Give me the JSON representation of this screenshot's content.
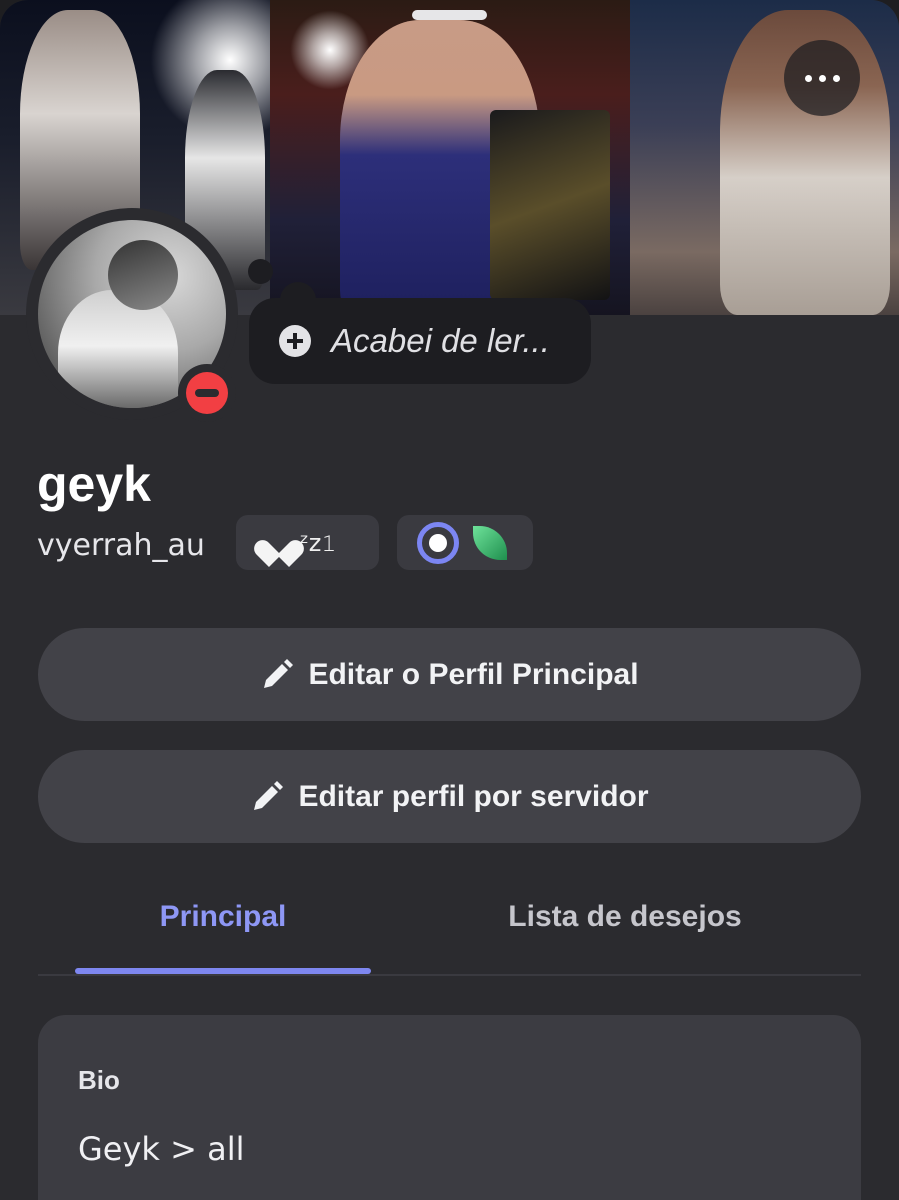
{
  "profile": {
    "display_name": "geyk",
    "username": "vyerrah_au",
    "custom_status": "Acabei de ler...",
    "status_chip_text": "ᶻz𝟷",
    "presence": "do-not-disturb"
  },
  "actions": {
    "edit_main_profile": "Editar o Perfil Principal",
    "edit_server_profile": "Editar perfil por servidor"
  },
  "tabs": [
    {
      "label": "Principal",
      "active": true
    },
    {
      "label": "Lista de desejos",
      "active": false
    }
  ],
  "bio": {
    "label": "Bio",
    "text": "Geyk > all"
  },
  "icons": {
    "more": "more-horizontal-icon",
    "add_status": "plus-circle-icon",
    "edit": "pencil-icon",
    "badge_1": "laurel-badge-icon",
    "badge_2": "leaf-badge-icon"
  },
  "colors": {
    "background": "#2b2b2f",
    "accent": "#7e87f0",
    "dnd": "#f23f43",
    "button": "#424248"
  }
}
